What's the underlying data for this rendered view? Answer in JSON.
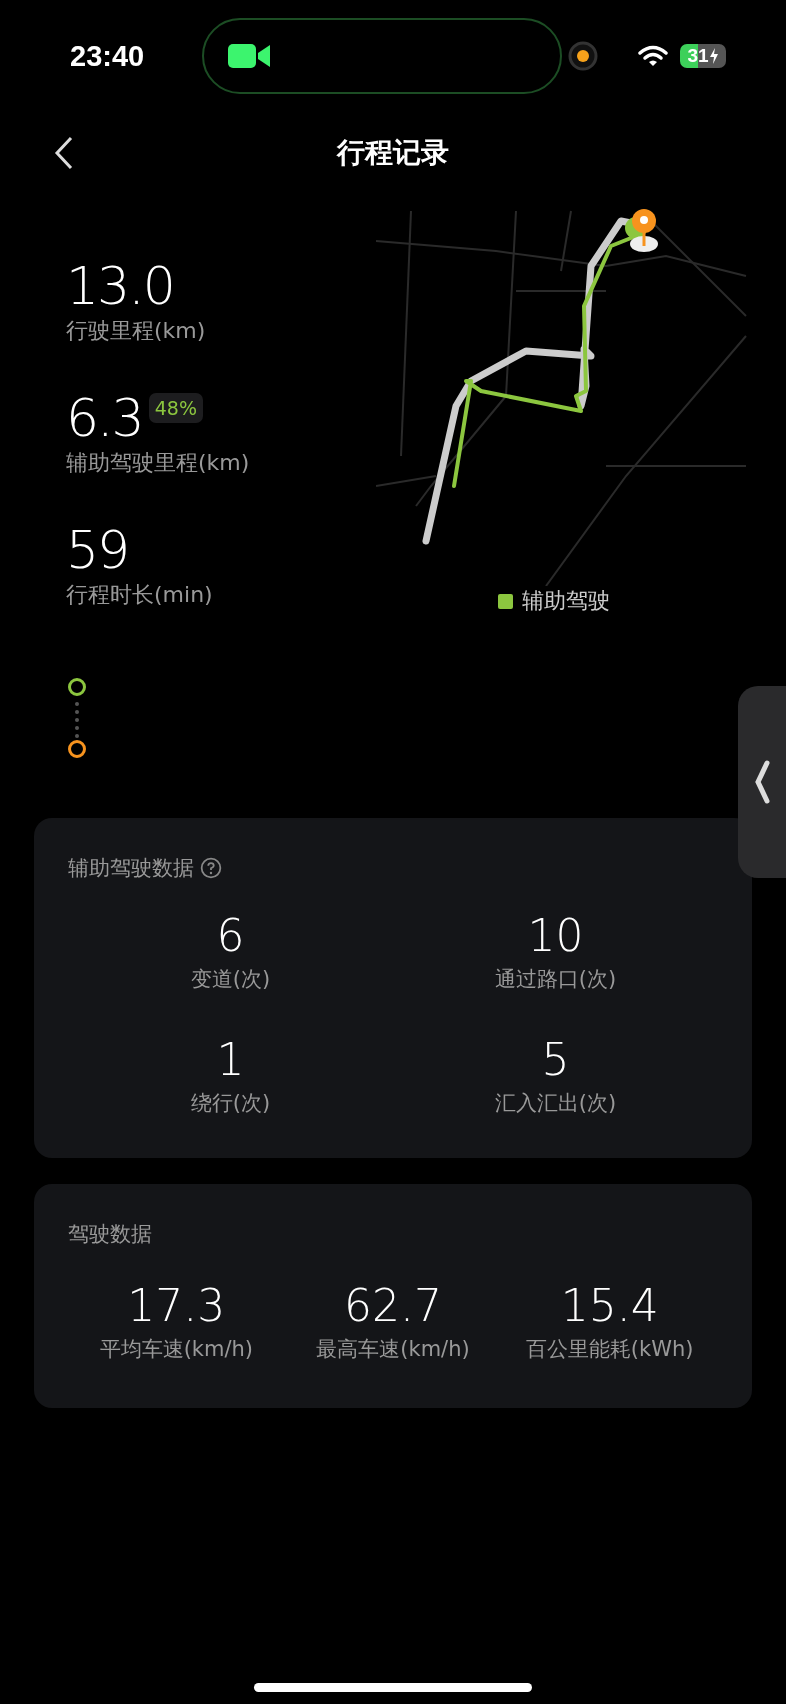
{
  "status_bar": {
    "time": "23:40",
    "battery": "31"
  },
  "header": {
    "title": "行程记录"
  },
  "summary": [
    {
      "value": "13.0",
      "label": "行驶里程(km)"
    },
    {
      "value": "6.3",
      "label": "辅助驾驶里程(km)",
      "badge": "48%"
    },
    {
      "value": "59",
      "label": "行程时长(min)"
    }
  ],
  "map": {
    "legend": "辅助驾驶"
  },
  "route": [
    {
      "color": "#8cc63f"
    },
    {
      "color": "#f7931e"
    }
  ],
  "assist_card": {
    "title": "辅助驾驶数据",
    "stats": [
      {
        "value": "6",
        "label": "变道(次)"
      },
      {
        "value": "10",
        "label": "通过路口(次)"
      },
      {
        "value": "1",
        "label": "绕行(次)"
      },
      {
        "value": "5",
        "label": "汇入汇出(次)"
      }
    ]
  },
  "drive_card": {
    "title": "驾驶数据",
    "stats": [
      {
        "value": "17.3",
        "label": "平均车速(km/h)"
      },
      {
        "value": "62.7",
        "label": "最高车速(km/h)"
      },
      {
        "value": "15.4",
        "label": "百公里能耗(kWh)"
      }
    ]
  }
}
